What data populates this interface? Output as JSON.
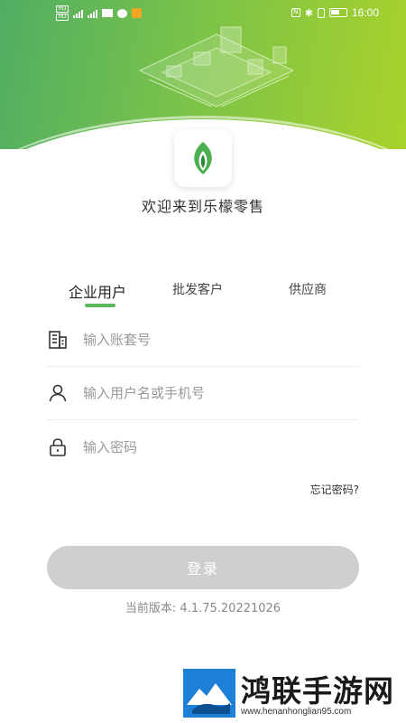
{
  "status_bar": {
    "time": "16:00",
    "sim_labels": [
      "HD",
      "HD"
    ],
    "network_labels": [
      "4G",
      "4G"
    ]
  },
  "header": {
    "welcome_text": "欢迎来到乐檬零售",
    "brand_color": "#5cb85c"
  },
  "tabs": [
    {
      "label": "企业用户",
      "active": true
    },
    {
      "label": "批发客户",
      "active": false
    },
    {
      "label": "供应商",
      "active": false
    }
  ],
  "form": {
    "account_placeholder": "输入账套号",
    "account_value": "",
    "username_placeholder": "输入用户名或手机号",
    "username_value": "",
    "password_placeholder": "输入密码",
    "password_value": "",
    "forgot_password": "忘记密码?",
    "login_button": "登录"
  },
  "version_text": "当前版本: 4.1.75.20221026",
  "watermark": {
    "title": "鸿联手游网",
    "url": "www.henanhonglian95.com"
  },
  "icons": {
    "account": "building-icon",
    "username": "user-icon",
    "password": "lock-icon",
    "logo": "leaf-logo-icon"
  }
}
